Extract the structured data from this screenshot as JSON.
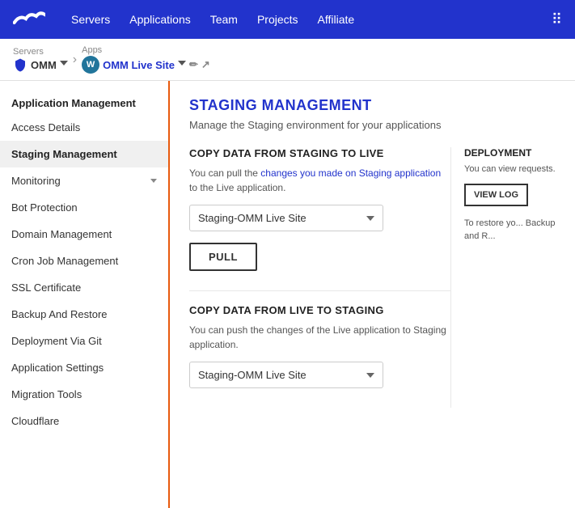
{
  "nav": {
    "links": [
      "Servers",
      "Applications",
      "Team",
      "Projects",
      "Affiliate"
    ],
    "grid_icon": "⊞"
  },
  "breadcrumb": {
    "servers_label": "Servers",
    "server_name": "OMM",
    "apps_label": "Apps",
    "app_name": "OMM Live Site"
  },
  "sidebar": {
    "section_title": "Application Management",
    "items": [
      {
        "label": "Access Details",
        "active": false,
        "has_chevron": false
      },
      {
        "label": "Staging Management",
        "active": true,
        "has_chevron": false
      },
      {
        "label": "Monitoring",
        "active": false,
        "has_chevron": true
      },
      {
        "label": "Bot Protection",
        "active": false,
        "has_chevron": false
      },
      {
        "label": "Domain Management",
        "active": false,
        "has_chevron": false
      },
      {
        "label": "Cron Job Management",
        "active": false,
        "has_chevron": false
      },
      {
        "label": "SSL Certificate",
        "active": false,
        "has_chevron": false
      },
      {
        "label": "Backup And Restore",
        "active": false,
        "has_chevron": false
      },
      {
        "label": "Deployment Via Git",
        "active": false,
        "has_chevron": false
      },
      {
        "label": "Application Settings",
        "active": false,
        "has_chevron": false
      },
      {
        "label": "Migration Tools",
        "active": false,
        "has_chevron": false
      },
      {
        "label": "Cloudflare",
        "active": false,
        "has_chevron": false
      }
    ]
  },
  "content": {
    "title": "STAGING MANAGEMENT",
    "subtitle": "Manage the Staging environment for your applications",
    "copy_to_live": {
      "heading": "COPY DATA FROM STAGING TO LIVE",
      "description_part1": "You can pull the changes you made on Staging application to the",
      "description_part2": "Live application.",
      "dropdown_value": "Staging-OMM Live Site",
      "dropdown_options": [
        "Staging-OMM Live Site"
      ],
      "pull_button": "PULL"
    },
    "deployment": {
      "heading": "DEPLOYMENT",
      "description": "You can view requests.",
      "view_log_button": "VIEW LOG",
      "restore_note": "To restore yo... Backup and R..."
    },
    "copy_to_staging": {
      "heading": "COPY DATA FROM LIVE TO STAGING",
      "description": "You can push the changes of the Live application to Staging application.",
      "dropdown_value": "Staging-OMM Live Site",
      "dropdown_options": [
        "Staging-OMM Live Site"
      ]
    }
  }
}
